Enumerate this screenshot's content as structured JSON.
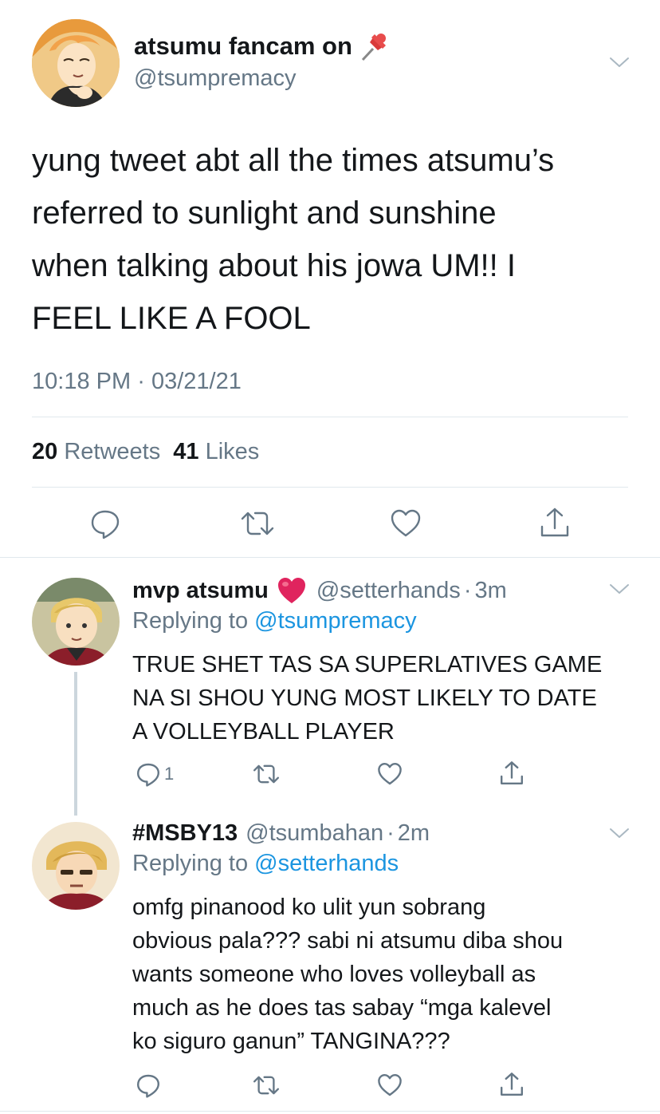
{
  "main_tweet": {
    "display_name": "atsumu fancam on",
    "handle": "@tsumpremacy",
    "name_emoji": "📌",
    "text_lines": [
      "yung tweet abt all the times atsumu’s",
      "referred to sunlight and sunshine",
      "when talking about his jowa UM!! I",
      "FEEL LIKE A FOOL"
    ],
    "time": "10:18 PM",
    "dot": "·",
    "date": "03/21/21",
    "retweets_count": "20",
    "retweets_label": "Retweets",
    "likes_count": "41",
    "likes_label": "Likes"
  },
  "replies": [
    {
      "display_name": "mvp atsumu",
      "emoji": "❤️",
      "handle": "@setterhands",
      "dot": "·",
      "age": "3m",
      "replying_label": "Replying to",
      "replying_handle": "@tsumpremacy",
      "text_lines": [
        "TRUE SHET TAS SA SUPERLATIVES GAME",
        "NA SI SHOU YUNG MOST LIKELY TO DATE",
        "A VOLLEYBALL PLAYER"
      ],
      "reply_count": "1"
    },
    {
      "display_name": "#MSBY13",
      "handle": "@tsumbahan",
      "dot": "·",
      "age": "2m",
      "replying_label": "Replying to",
      "replying_handle": "@setterhands",
      "text_lines": [
        "omfg pinanood ko ulit yun sobrang",
        "obvious pala??? sabi ni atsumu diba shou",
        "wants someone who loves volleyball as",
        "much as he does tas sabay “mga kalevel",
        "ko siguro ganun” TANGINA???"
      ]
    }
  ],
  "icons": {
    "reply": "speech-bubble-icon",
    "retweet": "retweet-arrows-icon",
    "like": "heart-outline-icon",
    "share": "share-upload-icon",
    "menu": "chevron-down-icon"
  },
  "colors": {
    "text": "#14171a",
    "muted": "#657786",
    "link": "#1b95e0",
    "divider": "#e1e8ed",
    "heart_emoji": "#e0245e"
  }
}
